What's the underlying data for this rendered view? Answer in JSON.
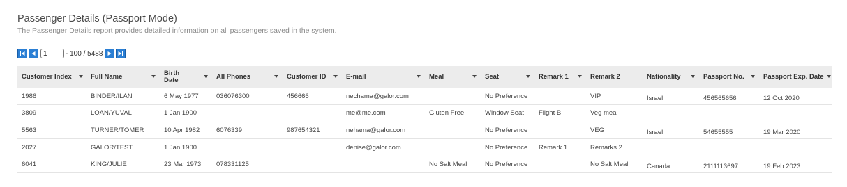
{
  "report": {
    "title": "Passenger Details (Passport Mode)",
    "subtitle": "The Passenger Details report provides detailed information on all passengers saved in the system."
  },
  "pager": {
    "current_page": "1",
    "range_text": "- 100 / 5488"
  },
  "table": {
    "headers": [
      {
        "label": "Customer Index",
        "sortable": true
      },
      {
        "label": "Full Name",
        "sortable": true
      },
      {
        "label": "Birth Date",
        "sortable": true
      },
      {
        "label": "All Phones",
        "sortable": true
      },
      {
        "label": "Customer ID",
        "sortable": true
      },
      {
        "label": "E-mail",
        "sortable": true
      },
      {
        "label": "Meal",
        "sortable": true
      },
      {
        "label": "Seat",
        "sortable": true
      },
      {
        "label": "Remark 1",
        "sortable": true
      },
      {
        "label": "Remark 2",
        "sortable": false
      },
      {
        "label": "Nationality",
        "sortable": true
      },
      {
        "label": "Passport No.",
        "sortable": true
      },
      {
        "label": "Passport Exp. Date",
        "sortable": true
      }
    ],
    "rows": [
      [
        "1986",
        "BINDER/ILAN",
        "6 May 1977",
        "036076300",
        "456666",
        "nechama@galor.com",
        "",
        "No Preference",
        "",
        "VIP",
        "Israel",
        "456565656",
        "12 Oct 2020"
      ],
      [
        "3809",
        "LOAN/YUVAL",
        "1 Jan 1900",
        "",
        "",
        "me@me.com",
        "Gluten Free",
        "Window Seat",
        "Flight B",
        "Veg meal",
        "",
        "",
        ""
      ],
      [
        "5563",
        "TURNER/TOMER",
        "10 Apr 1982",
        "6076339",
        "987654321",
        "nehama@galor.com",
        "",
        "No Preference",
        "",
        "VEG",
        "Israel",
        "54655555",
        "19 Mar 2020"
      ],
      [
        "2027",
        "GALOR/TEST",
        "1 Jan 1900",
        "",
        "",
        "denise@galor.com",
        "",
        "No Preference",
        "Remark 1",
        "Remarks 2",
        "",
        "",
        ""
      ],
      [
        "6041",
        "KING/JULIE",
        "23 Mar 1973",
        "078331125",
        "",
        "",
        "No Salt Meal",
        "No Preference",
        "",
        "No Salt Meal",
        "Canada",
        "2111113697",
        "19 Feb 2023"
      ]
    ]
  },
  "colors": {
    "pager_button": "#2b7fd4",
    "header_bg": "#ececec"
  }
}
